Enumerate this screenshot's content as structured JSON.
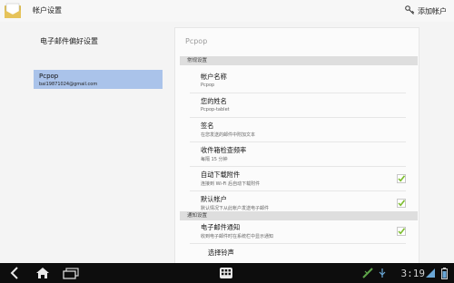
{
  "actionbar": {
    "title": "帐户设置",
    "add_account_label": "添加帐户"
  },
  "left": {
    "header": "电子邮件偏好设置",
    "account": {
      "name": "Pcpop",
      "email": "bai19871024@gmail.com"
    }
  },
  "panel": {
    "title": "Pcpop",
    "sections": {
      "general": "常规设置",
      "notifications": "通知设置"
    },
    "items": [
      {
        "title": "帐户名称",
        "subtitle": "Pcpop"
      },
      {
        "title": "您的姓名",
        "subtitle": "Pcpop-tablet"
      },
      {
        "title": "签名",
        "subtitle": "在您发送的邮件中附加文本"
      },
      {
        "title": "收件箱检查频率",
        "subtitle": "每隔 15 分钟"
      },
      {
        "title": "自动下载附件",
        "subtitle": "连接到 Wi-Fi 后自动下载附件",
        "checked": true
      },
      {
        "title": "默认帐户",
        "subtitle": "默认情况下从此帐户发送电子邮件",
        "checked": true
      },
      {
        "title": "电子邮件通知",
        "subtitle": "收到电子邮件时在系统栏中显示通知",
        "checked": true
      },
      {
        "title": "选择铃声",
        "subtitle": ""
      }
    ]
  },
  "statusbar": {
    "time": "3:19"
  },
  "colors": {
    "selection": "#aac3ea",
    "check": "#7dbd2f",
    "navbar": "#0d0d0d"
  }
}
